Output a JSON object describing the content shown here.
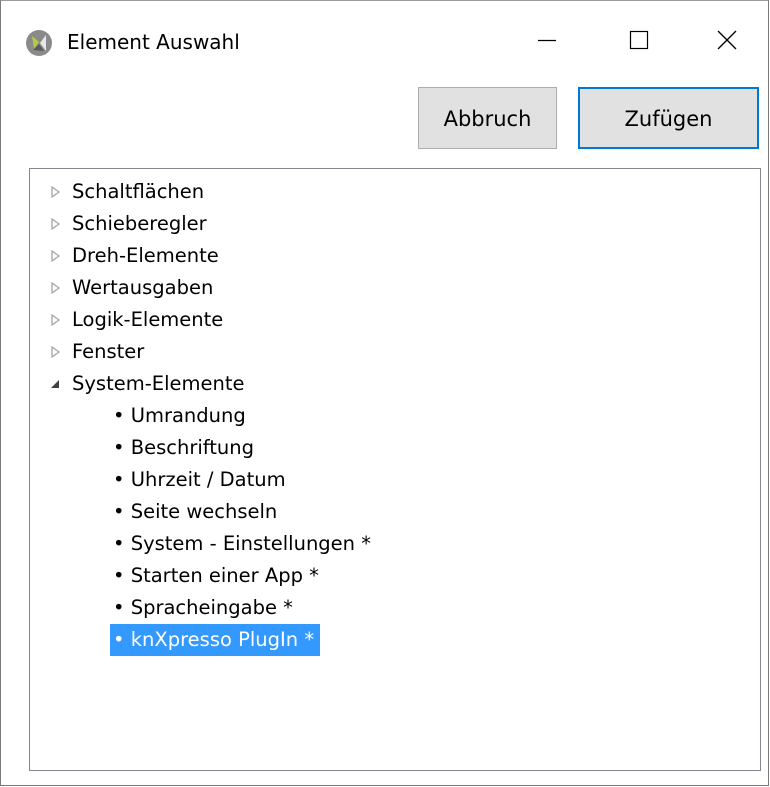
{
  "window": {
    "title": "Element Auswahl",
    "icon": "app-logo-icon",
    "controls": {
      "minimize": "minimize-icon",
      "maximize": "maximize-icon",
      "close": "close-icon"
    }
  },
  "toolbar": {
    "cancel_label": "Abbruch",
    "add_label": "Zufügen"
  },
  "tree": {
    "groups": [
      {
        "label": "Schaltflächen",
        "expanded": false
      },
      {
        "label": "Schieberegler",
        "expanded": false
      },
      {
        "label": "Dreh-Elemente",
        "expanded": false
      },
      {
        "label": "Wertausgaben",
        "expanded": false
      },
      {
        "label": "Logik-Elemente",
        "expanded": false
      },
      {
        "label": "Fenster",
        "expanded": false
      },
      {
        "label": "System-Elemente",
        "expanded": true
      }
    ],
    "system_items": [
      "• Umrandung",
      "• Beschriftung",
      "• Uhrzeit / Datum",
      "• Seite wechseln",
      "• System - Einstellungen *",
      "• Starten einer App *",
      "• Spracheingabe *",
      "• knXpresso PlugIn *"
    ],
    "selected_item": "• knXpresso PlugIn *"
  },
  "colors": {
    "selection": "#3399ff",
    "accent_border": "#0078d7",
    "button_face": "#e1e1e1"
  }
}
